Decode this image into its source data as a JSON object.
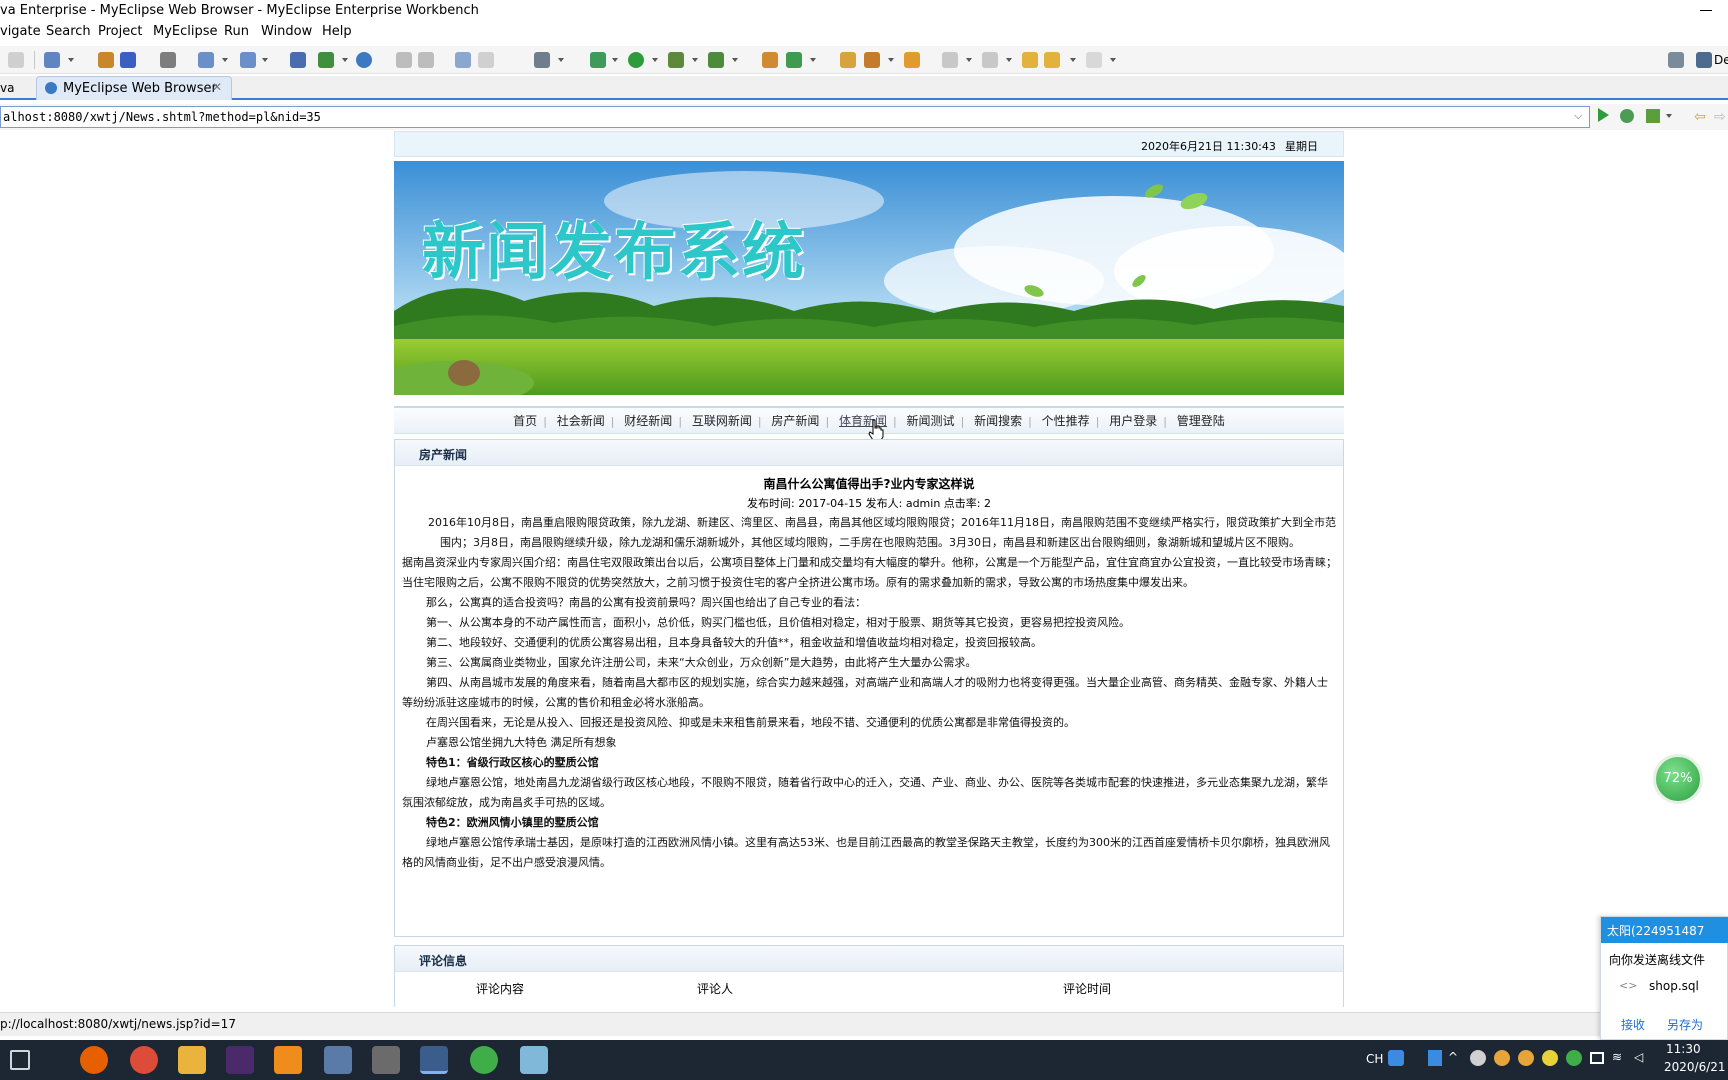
{
  "window": {
    "title": "va Enterprise - MyEclipse Web Browser - MyEclipse Enterprise Workbench"
  },
  "menu": {
    "items": [
      "vigate",
      "Search",
      "Project",
      "MyEclipse",
      "Run",
      "Window",
      "Help"
    ]
  },
  "toolbar": {
    "perspective_label": "De"
  },
  "tabs": {
    "left_partial": "va",
    "active": "MyEclipse Web Browser"
  },
  "browser": {
    "url": "alhost:8080/xwtj/News.shtml?method=pl&nid=35"
  },
  "page": {
    "datetime": "2020年6月21日 11:30:43",
    "weekday": "星期日",
    "banner_title": "新闻发布系统",
    "nav": [
      "首页",
      "社会新闻",
      "财经新闻",
      "互联网新闻",
      "房产新闻",
      "体育新闻",
      "新闻测试",
      "新闻搜索",
      "个性推荐",
      "用户登录",
      "管理登陆"
    ],
    "section_title": "房产新闻",
    "article": {
      "title": "南昌什么公寓值得出手?业内专家这样说",
      "meta": "发布时间: 2017-04-15 发布人: admin 点击率: 2",
      "paragraphs": [
        "2016年10月8日，南昌重启限购限贷政策，除九龙湖、新建区、湾里区、南昌县，南昌其他区域均限购限贷；2016年11月18日，南昌限购范围不变继续严格实行，限贷政策扩大到全市范围内；3月8日，南昌限购继续升级，除九龙湖和儒乐湖新城外，其他区域均限购，二手房在也限购范围。3月30日，南昌县和新建区出台限购细则，象湖新城和望城片区不限购。",
        "据南昌资深业内专家周兴国介绍：南昌住宅双限政策出台以后，公寓项目整体上门量和成交量均有大幅度的攀升。他称，公寓是一个万能型产品，宜住宜商宜办公宜投资，一直比较受市场青睐；当住宅限购之后，公寓不限购不限贷的优势突然放大，之前习惯于投资住宅的客户全挤进公寓市场。原有的需求叠加新的需求，导致公寓的市场热度集中爆发出来。",
        "那么，公寓真的适合投资吗？南昌的公寓有投资前景吗？周兴国也给出了自己专业的看法：",
        "第一、从公寓本身的不动产属性而言，面积小，总价低，购买门槛也低，且价值相对稳定，相对于股票、期货等其它投资，更容易把控投资风险。",
        "第二、地段较好、交通便利的优质公寓容易出租，且本身具备较大的升值**，租金收益和增值收益均相对稳定，投资回报较高。",
        "第三、公寓属商业类物业，国家允许注册公司，未来“大众创业，万众创新”是大趋势，由此将产生大量办公需求。",
        "第四、从南昌城市发展的角度来看，随着南昌大都市区的规划实施，综合实力越来越强，对高端产业和高端人才的吸附力也将变得更强。当大量企业高管、商务精英、金融专家、外籍人士等纷纷派驻这座城市的时候，公寓的售价和租金必将水涨船高。",
        "在周兴国看来，无论是从投入、回报还是投资风险、抑或是未来租售前景来看，地段不错、交通便利的优质公寓都是非常值得投资的。",
        "卢塞恩公馆坐拥九大特色 满足所有想象",
        "特色1：省级行政区核心的墅质公馆",
        "绿地卢塞恩公馆，地处南昌九龙湖省级行政区核心地段，不限购不限贷，随着省行政中心的迁入，交通、产业、商业、办公、医院等各类城市配套的快速推进，多元业态集聚九龙湖，繁华氛围浓郁绽放，成为南昌炙手可热的区域。",
        "特色2：欧洲风情小镇里的墅质公馆",
        "绿地卢塞恩公馆传承瑞士基因，是原味打造的江西欧洲风情小镇。这里有高达53米、也是目前江西最高的教堂圣保路天主教堂，长度约为300米的江西首座爱情桥卡贝尔廓桥，独具欧洲风格的风情商业街，足不出户感受浪漫风情。"
      ]
    },
    "comments": {
      "title": "评论信息",
      "headers": [
        "评论内容",
        "评论人",
        "评论时间"
      ]
    }
  },
  "statusbar": {
    "text": "p://localhost:8080/xwtj/news.jsp?id=17"
  },
  "net_widget": {
    "percent": "72%"
  },
  "chat": {
    "title": "太阳(224951487",
    "line": "向你发送离线文件",
    "file": "shop.sql",
    "accept": "接收",
    "save_as": "另存为"
  },
  "tray": {
    "ime": "CH",
    "time": "11:30",
    "date": "2020/6/21"
  },
  "colors": {
    "accent": "#3b7bd1",
    "taskbar": "#1c2733",
    "banner_text": "#2ec7c9"
  }
}
